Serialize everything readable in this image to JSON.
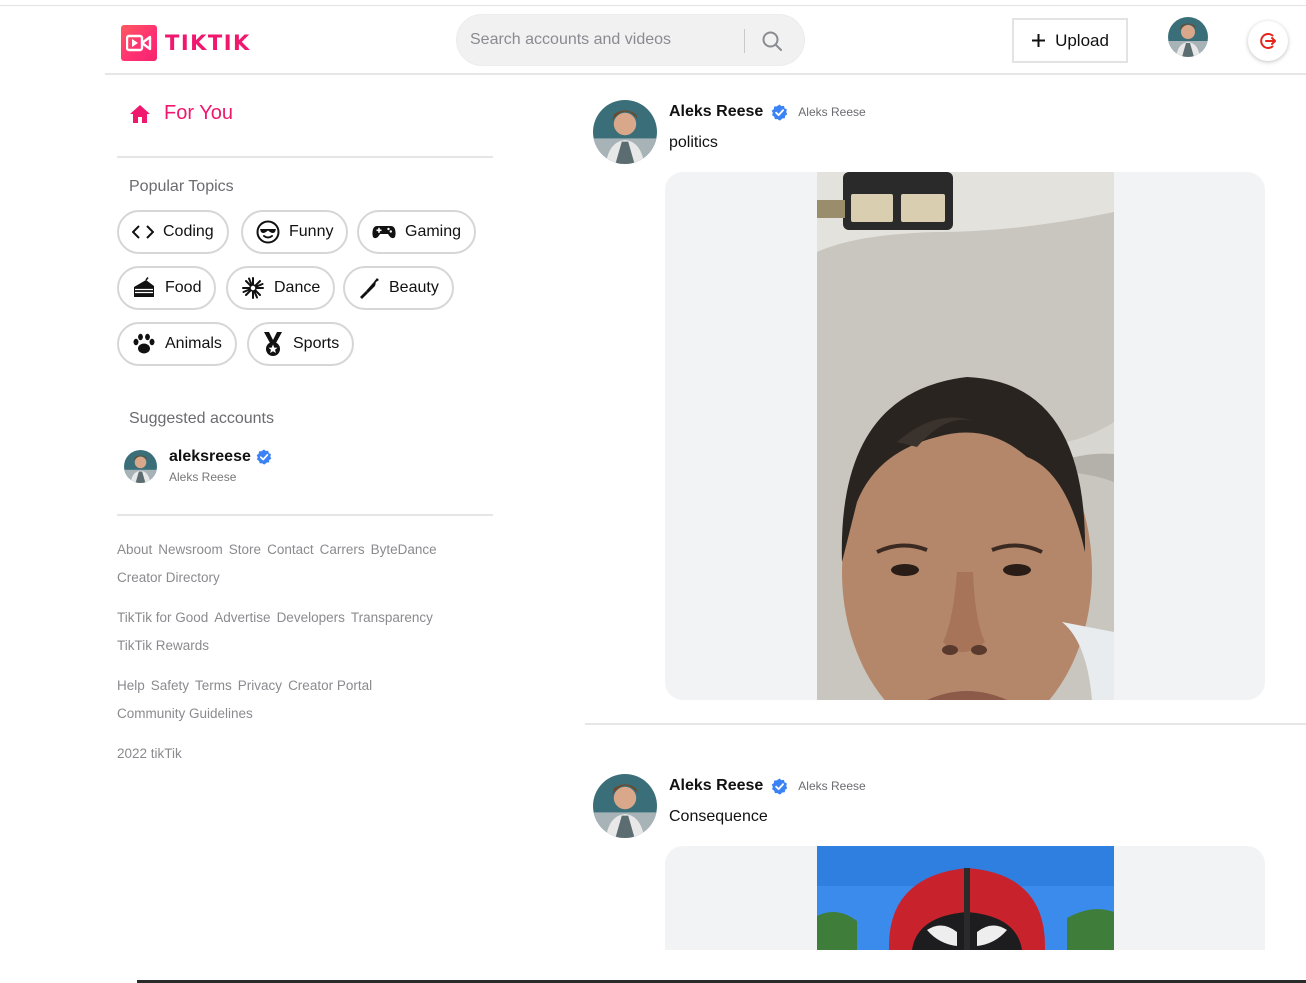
{
  "brand": {
    "name": "TIKTIK",
    "color": "#f0186e"
  },
  "header": {
    "search_placeholder": "Search accounts and videos",
    "upload_label": "Upload",
    "upload_icon": "plus-icon",
    "search_icon": "search-icon",
    "logout_icon": "logout-icon",
    "logout_color": "#e5251b"
  },
  "sidebar": {
    "for_you": "For You",
    "popular_topics_title": "Popular Topics",
    "topics": [
      {
        "label": "Coding",
        "icon": "code-icon"
      },
      {
        "label": "Funny",
        "icon": "sunglasses-face-icon"
      },
      {
        "label": "Gaming",
        "icon": "gamepad-icon"
      },
      {
        "label": "Food",
        "icon": "cake-icon"
      },
      {
        "label": "Dance",
        "icon": "dance-icon"
      },
      {
        "label": "Beauty",
        "icon": "lipstick-icon"
      },
      {
        "label": "Animals",
        "icon": "paw-icon"
      },
      {
        "label": "Sports",
        "icon": "medal-icon"
      }
    ],
    "suggested_title": "Suggested accounts",
    "suggested": [
      {
        "username": "aleksreese",
        "display_name": "Aleks Reese",
        "verified": true
      }
    ],
    "footer": {
      "group1": [
        "About",
        "Newsroom",
        "Store",
        "Contact",
        "Carrers",
        "ByteDance",
        "Creator Directory"
      ],
      "group2": [
        "TikTik for Good",
        "Advertise",
        "Developers",
        "Transparency",
        "TikTik Rewards"
      ],
      "group3": [
        "Help",
        "Safety",
        "Terms",
        "Privacy",
        "Creator Portal",
        "Community Guidelines"
      ],
      "copyright": "2022 tikTik"
    }
  },
  "feed": {
    "posts": [
      {
        "name": "Aleks Reese",
        "handle": "Aleks Reese",
        "verified": true,
        "caption": "politics"
      },
      {
        "name": "Aleks Reese",
        "handle": "Aleks Reese",
        "verified": true,
        "caption": "Consequence"
      }
    ]
  },
  "colors": {
    "accent": "#f0186e",
    "verified": "#3b82f6",
    "card_bg": "#f2f3f5"
  }
}
